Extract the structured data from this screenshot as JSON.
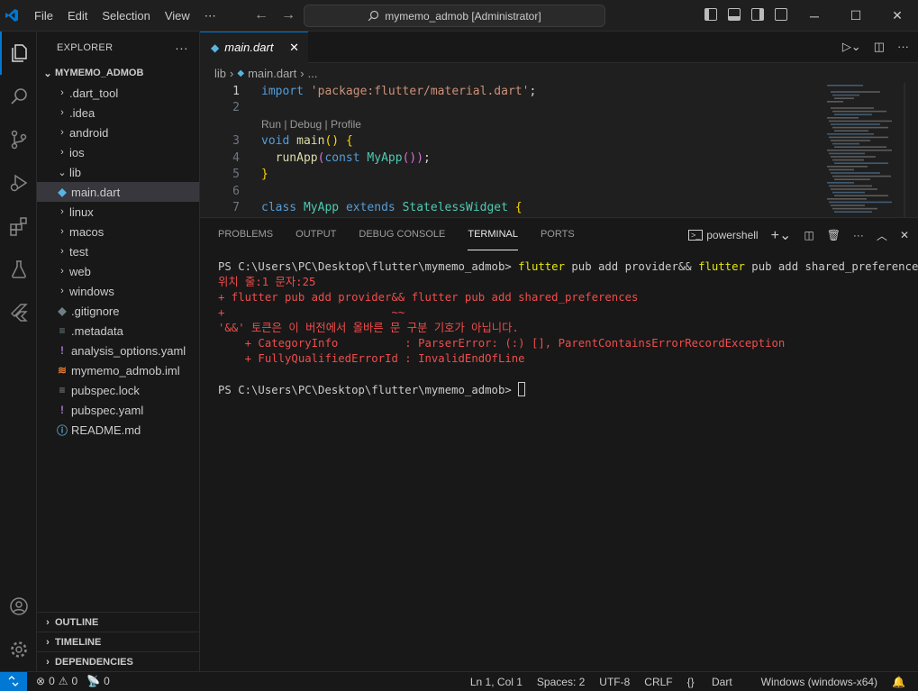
{
  "titlebar": {
    "menu": [
      "File",
      "Edit",
      "Selection",
      "View",
      "⋯"
    ],
    "search": "mymemo_admob [Administrator]"
  },
  "sidebar": {
    "title": "EXPLORER",
    "root": "MYMEMO_ADMOB",
    "items": [
      {
        "label": ".dart_tool",
        "type": "folder",
        "depth": 0
      },
      {
        "label": ".idea",
        "type": "folder",
        "depth": 0
      },
      {
        "label": "android",
        "type": "folder",
        "depth": 0
      },
      {
        "label": "ios",
        "type": "folder",
        "depth": 0
      },
      {
        "label": "lib",
        "type": "folder-open",
        "depth": 0
      },
      {
        "label": "main.dart",
        "type": "dart",
        "depth": 1,
        "selected": true
      },
      {
        "label": "linux",
        "type": "folder",
        "depth": 0
      },
      {
        "label": "macos",
        "type": "folder",
        "depth": 0
      },
      {
        "label": "test",
        "type": "folder",
        "depth": 0
      },
      {
        "label": "web",
        "type": "folder",
        "depth": 0
      },
      {
        "label": "windows",
        "type": "folder",
        "depth": 0
      },
      {
        "label": ".gitignore",
        "type": "git",
        "depth": 0
      },
      {
        "label": ".metadata",
        "type": "meta",
        "depth": 0
      },
      {
        "label": "analysis_options.yaml",
        "type": "yaml",
        "depth": 0
      },
      {
        "label": "mymemo_admob.iml",
        "type": "iml",
        "depth": 0
      },
      {
        "label": "pubspec.lock",
        "type": "lock",
        "depth": 0
      },
      {
        "label": "pubspec.yaml",
        "type": "yaml",
        "depth": 0
      },
      {
        "label": "README.md",
        "type": "info",
        "depth": 0
      }
    ],
    "sections": [
      "OUTLINE",
      "TIMELINE",
      "DEPENDENCIES"
    ]
  },
  "editor": {
    "tab": "main.dart",
    "breadcrumb": [
      "lib",
      "main.dart",
      "..."
    ],
    "codelens": "Run | Debug | Profile",
    "lines": [
      {
        "n": "1",
        "tokens": [
          [
            "kw",
            "import"
          ],
          [
            "pl",
            " "
          ],
          [
            "str",
            "'package:flutter/material.dart'"
          ],
          [
            "pl",
            ";"
          ]
        ]
      },
      {
        "n": "2",
        "tokens": []
      },
      {
        "n": "",
        "lens": true
      },
      {
        "n": "3",
        "tokens": [
          [
            "kw",
            "void"
          ],
          [
            "pl",
            " "
          ],
          [
            "fn",
            "main"
          ],
          [
            "br1",
            "()"
          ],
          [
            "pl",
            " "
          ],
          [
            "br1",
            "{"
          ]
        ]
      },
      {
        "n": "4",
        "tokens": [
          [
            "pl",
            "  "
          ],
          [
            "fn",
            "runApp"
          ],
          [
            "br2",
            "("
          ],
          [
            "kw",
            "const"
          ],
          [
            "pl",
            " "
          ],
          [
            "cls",
            "MyApp"
          ],
          [
            "br2",
            "()"
          ],
          [
            "br2",
            ")"
          ],
          [
            "pl",
            ";"
          ]
        ]
      },
      {
        "n": "5",
        "tokens": [
          [
            "br1",
            "}"
          ]
        ]
      },
      {
        "n": "6",
        "tokens": []
      },
      {
        "n": "7",
        "tokens": [
          [
            "kw",
            "class"
          ],
          [
            "pl",
            " "
          ],
          [
            "cls",
            "MyApp"
          ],
          [
            "pl",
            " "
          ],
          [
            "kw",
            "extends"
          ],
          [
            "pl",
            " "
          ],
          [
            "cls",
            "StatelessWidget"
          ],
          [
            "pl",
            " "
          ],
          [
            "br1",
            "{"
          ]
        ]
      }
    ]
  },
  "panel": {
    "tabs": [
      "PROBLEMS",
      "OUTPUT",
      "DEBUG CONSOLE",
      "TERMINAL",
      "PORTS"
    ],
    "active_tab": "TERMINAL",
    "shell": "powershell",
    "prompt": "PS C:\\Users\\PC\\Desktop\\flutter\\mymemo_admob>",
    "cmd_part1": "flutter",
    "cmd_part2": " pub add provider&& ",
    "cmd_part3": "flutter",
    "cmd_part4": " pub add shared_preferences",
    "err_lines": [
      "위치 줄:1 문자:25",
      "+ flutter pub add provider&& flutter pub add shared_preferences",
      "+                         ~~",
      "'&&' 토큰은 이 버전에서 올바른 문 구분 기호가 아닙니다.",
      "    + CategoryInfo          : ParserError: (:) [], ParentContainsErrorRecordException",
      "    + FullyQualifiedErrorId : InvalidEndOfLine"
    ]
  },
  "status": {
    "errors": "0",
    "warnings": "0",
    "ports": "0",
    "position": "Ln 1, Col 1",
    "spaces": "Spaces: 2",
    "encoding": "UTF-8",
    "eol": "CRLF",
    "language": "Dart",
    "device": "Windows (windows-x64)"
  },
  "colors": {
    "accent": "#0078d4",
    "error": "#f14c4c",
    "command": "#e5e510"
  }
}
